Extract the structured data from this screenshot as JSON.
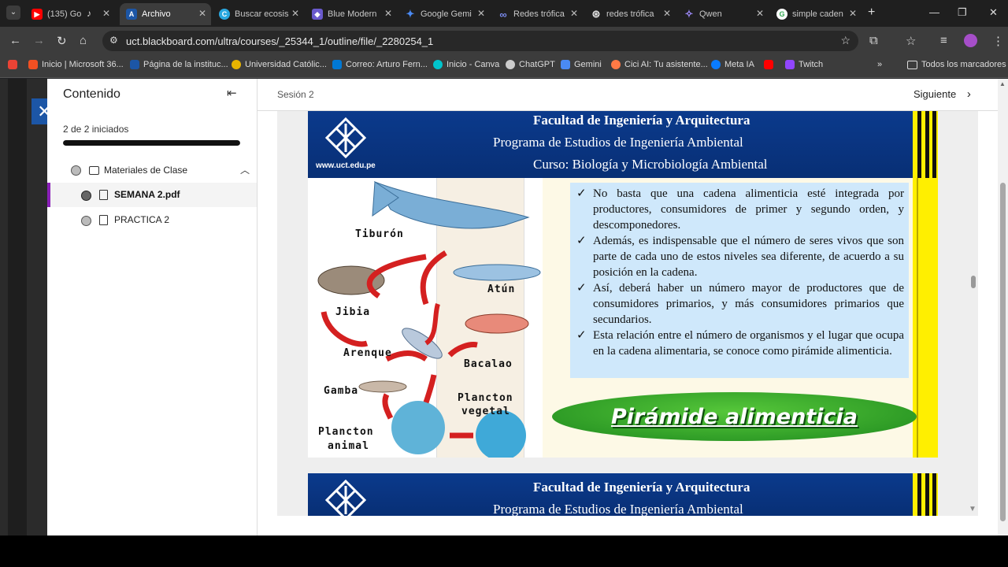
{
  "browser": {
    "tabs": [
      {
        "title": "(135) Go",
        "color": "#ff0000",
        "glyph": "▶"
      },
      {
        "title": "Archivo",
        "color": "#1c56a6",
        "glyph": "A"
      },
      {
        "title": "Buscar ecosis",
        "color": "#2aa8e0",
        "glyph": "C"
      },
      {
        "title": "Blue Modern",
        "color": "#6a5acd",
        "glyph": "◆"
      },
      {
        "title": "Google Gemi",
        "color": "#4a8af4",
        "glyph": "✦"
      },
      {
        "title": "Redes trófica",
        "color": "#4a60c8",
        "glyph": "∞"
      },
      {
        "title": "redes trófica",
        "color": "#444444",
        "glyph": "⊛"
      },
      {
        "title": "Qwen",
        "color": "#7b61ff",
        "glyph": "✧"
      },
      {
        "title": "simple caden",
        "color": "#34a853",
        "glyph": "G"
      }
    ],
    "url": "uct.blackboard.com/ultra/courses/_25344_1/outline/file/_2280254_1",
    "bookmarks": [
      {
        "label": "Inicio | Microsoft 36...",
        "color": "#f25022"
      },
      {
        "label": "Página de la instituc...",
        "color": "#1c56a6"
      },
      {
        "label": "Universidad Católic...",
        "color": "#e8b400"
      },
      {
        "label": "Correo: Arturo Fern...",
        "color": "#0078d4"
      },
      {
        "label": "Inicio - Canva",
        "color": "#00c4cc"
      },
      {
        "label": "ChatGPT",
        "color": "#cccccc"
      },
      {
        "label": "Gemini",
        "color": "#4a8af4"
      },
      {
        "label": "Cici AI: Tu asistente...",
        "color": "#ff7a45"
      },
      {
        "label": "Meta IA",
        "color": "#0a7cff"
      },
      {
        "label": "",
        "color": "#ff0000"
      },
      {
        "label": "Twitch",
        "color": "#9146ff"
      }
    ],
    "all_bookmarks": "Todos los marcadores"
  },
  "sidebar": {
    "title": "Contenido",
    "progress_text": "2 de 2 iniciados",
    "progress": 1.0,
    "folder": "Materiales de Clase",
    "items": [
      "SEMANA 2.pdf",
      "PRACTICA 2"
    ]
  },
  "viewer": {
    "breadcrumb": "Sesión 2",
    "next": "Siguiente"
  },
  "slide": {
    "header": [
      "Facultad de Ingeniería y Arquitectura",
      "Programa de Estudios de  Ingeniería Ambiental",
      "Curso: Biología y Microbiología Ambiental"
    ],
    "site": "www.uct.edu.pe",
    "labels": {
      "tiburon": "Tiburón",
      "atun": "Atún",
      "jibia": "Jibia",
      "arenque": "Arenque",
      "bacalao": "Bacalao",
      "gamba": "Gamba",
      "plancton_vegetal_1": "Plancton",
      "plancton_vegetal_2": "vegetal",
      "plancton_animal_1": "Plancton",
      "plancton_animal_2": "animal"
    },
    "bullets": [
      "No basta que una cadena alimenticia esté integrada por productores, consumidores de primer y segundo orden, y descomponedores.",
      "Además, es indispensable que el número de seres vivos que son parte de cada uno de estos niveles sea diferente, de acuerdo a su posición en la cadena.",
      "Así, deberá haber un número mayor de productores que de consumidores primarios, y más consumidores primarios que secundarios.",
      "Esta relación entre el número de organismos y el lugar que ocupa en la cadena alimentaria, se conoce como pirámide alimenticia."
    ],
    "pyramid": "Pirámide alimenticia"
  },
  "slide2": {
    "header": [
      "Facultad de Ingeniería y Arquitectura",
      "Programa de Estudios de  Ingeniería Ambiental"
    ]
  }
}
